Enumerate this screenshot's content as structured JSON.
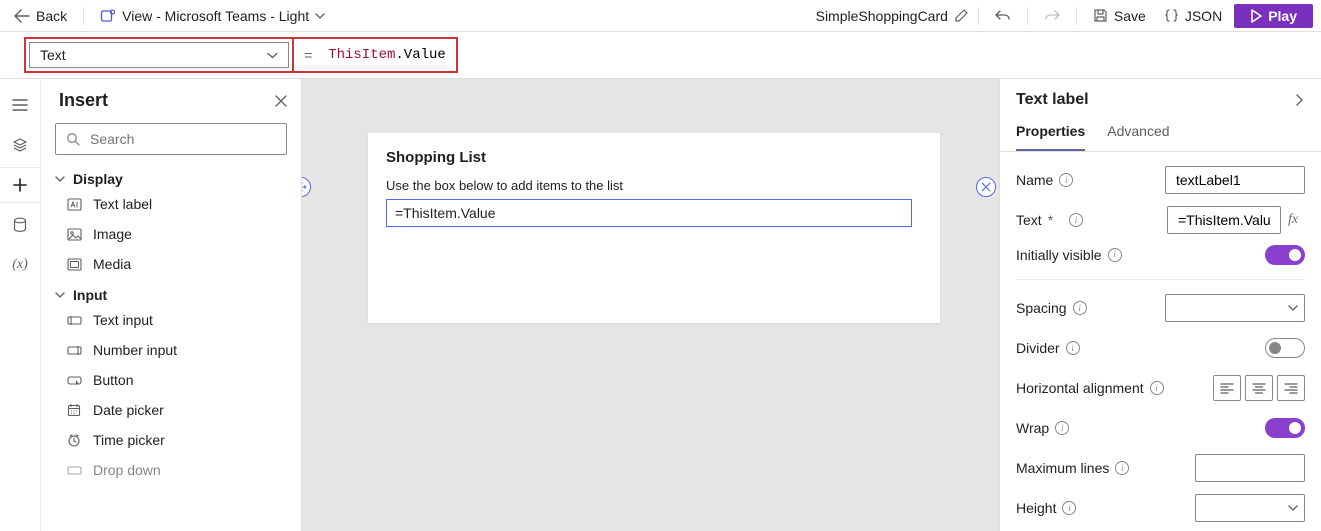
{
  "toolbar": {
    "back": "Back",
    "view_label": "View - Microsoft Teams - Light",
    "app_name": "SimpleShoppingCard",
    "save": "Save",
    "json": "JSON",
    "play": "Play"
  },
  "highlight": {
    "dropdown_value": "Text",
    "formula_prefix": "ThisItem",
    "formula_suffix": ".Value"
  },
  "insert": {
    "title": "Insert",
    "search_placeholder": "Search",
    "groups": [
      {
        "label": "Display",
        "items": [
          {
            "label": "Text label"
          },
          {
            "label": "Image"
          },
          {
            "label": "Media"
          }
        ]
      },
      {
        "label": "Input",
        "items": [
          {
            "label": "Text input"
          },
          {
            "label": "Number input"
          },
          {
            "label": "Button"
          },
          {
            "label": "Date picker"
          },
          {
            "label": "Time picker"
          },
          {
            "label": "Drop down"
          }
        ]
      }
    ]
  },
  "card": {
    "title": "Shopping List",
    "subtitle": "Use the box below to add items to the list",
    "item_value": "=ThisItem.Value"
  },
  "panel": {
    "title": "Text label",
    "tabs": {
      "properties": "Properties",
      "advanced": "Advanced"
    },
    "name_label": "Name",
    "name_value": "textLabel1",
    "text_label": "Text",
    "text_required": "*",
    "text_value": "=ThisItem.Value",
    "initially_visible_label": "Initially visible",
    "spacing_label": "Spacing",
    "divider_label": "Divider",
    "halign_label": "Horizontal alignment",
    "wrap_label": "Wrap",
    "maxlines_label": "Maximum lines",
    "height_label": "Height",
    "toggles": {
      "initially_visible": true,
      "divider": false,
      "wrap": true
    }
  }
}
